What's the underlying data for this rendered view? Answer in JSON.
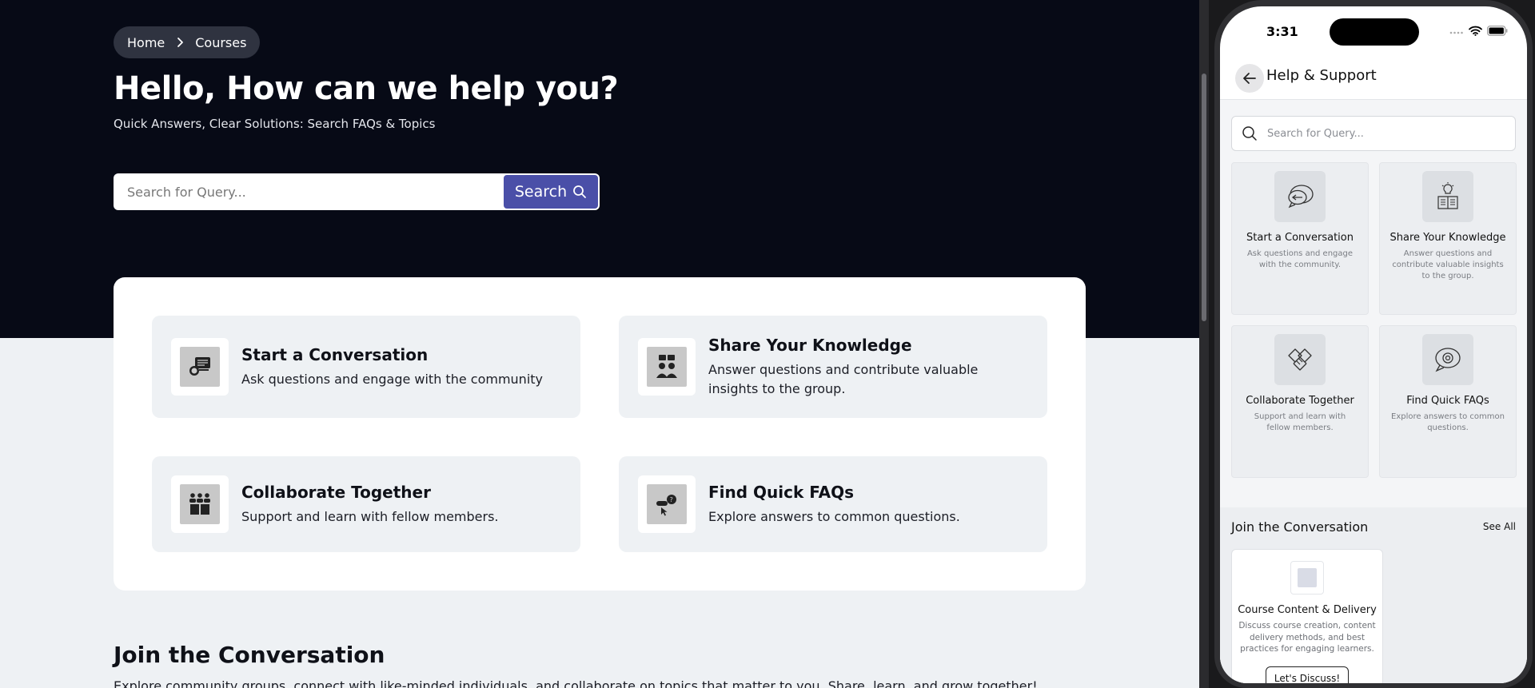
{
  "breadcrumb": {
    "home": "Home",
    "current": "Courses"
  },
  "hero": {
    "title": "Hello, How can we help you?",
    "subtitle": "Quick Answers, Clear Solutions: Search FAQs & Topics",
    "search_placeholder": "Search for Query...",
    "search_button": "Search"
  },
  "features": [
    {
      "title": "Start a Conversation",
      "desc": "Ask questions and engage with the community",
      "icon": "conversation-icon"
    },
    {
      "title": "Share Your Knowledge",
      "desc": "Answer questions and contribute valuable insights to the group.",
      "icon": "knowledge-icon"
    },
    {
      "title": "Collaborate Together",
      "desc": "Support and learn with fellow members.",
      "icon": "collaborate-icon"
    },
    {
      "title": "Find Quick FAQs",
      "desc": "Explore answers to common questions.",
      "icon": "faq-icon"
    }
  ],
  "join": {
    "title": "Join the Conversation",
    "subtitle": "Explore community groups, connect with like-minded individuals, and collaborate on topics that matter to you. Share, learn, and grow together!"
  },
  "phone": {
    "time": "3:31",
    "header_title": "Help & Support",
    "search_placeholder": "Search for Query...",
    "cards": [
      {
        "title": "Start a Conversation",
        "desc": "Ask questions and engage with the community."
      },
      {
        "title": "Share Your Knowledge",
        "desc": "Answer questions and contribute valuable insights to the group."
      },
      {
        "title": "Collaborate Together",
        "desc": "Support and learn with fellow members."
      },
      {
        "title": "Find Quick FAQs",
        "desc": "Explore answers to common questions."
      }
    ],
    "join_title": "Join the Conversation",
    "see_all": "See All",
    "course": {
      "title": "Course Content & Delivery",
      "desc": "Discuss course creation, content delivery methods, and best practices for engaging learners.",
      "button": "Let's Discuss!"
    }
  },
  "colors": {
    "hero_bg": "#070a16",
    "accent": "#4a4fa8",
    "page_bg": "#eef1f4"
  }
}
